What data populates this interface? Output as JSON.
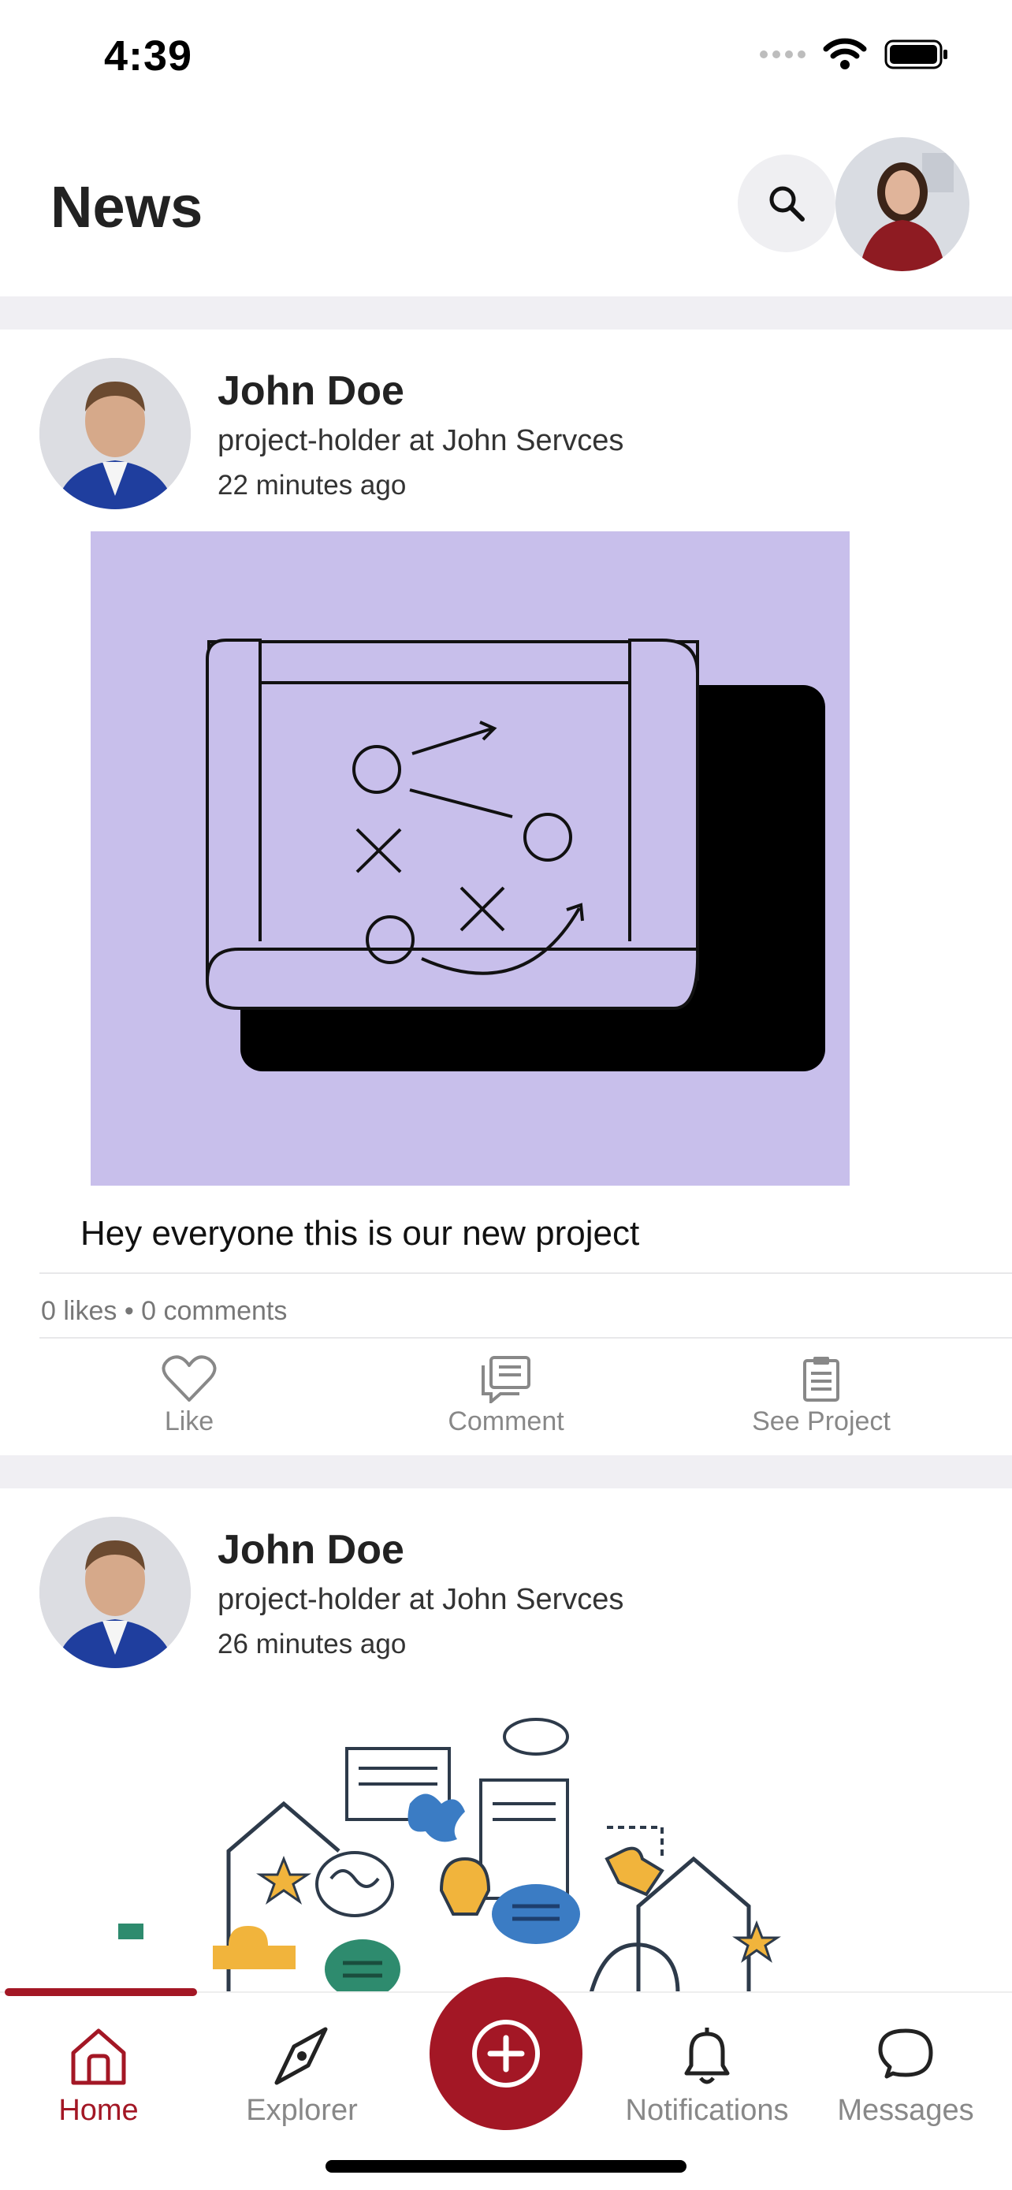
{
  "status_bar": {
    "time": "4:39"
  },
  "header": {
    "title": "News"
  },
  "posts": [
    {
      "author": "John Doe",
      "subtitle": "project-holder at John Servces",
      "time": "22 minutes ago",
      "text": "Hey everyone this is our new project",
      "stats": "0 likes • 0 comments",
      "image_bg": "#c8bfeb"
    },
    {
      "author": "John Doe",
      "subtitle": "project-holder at John Servces",
      "time": "26 minutes ago"
    }
  ],
  "actions": {
    "like": "Like",
    "comment": "Comment",
    "see_project": "See Project"
  },
  "tabs": {
    "home": "Home",
    "explorer": "Explorer",
    "notifications": "Notifications",
    "messages": "Messages"
  },
  "colors": {
    "accent": "#a31725",
    "separator": "#f0eff3",
    "muted": "#888888"
  }
}
